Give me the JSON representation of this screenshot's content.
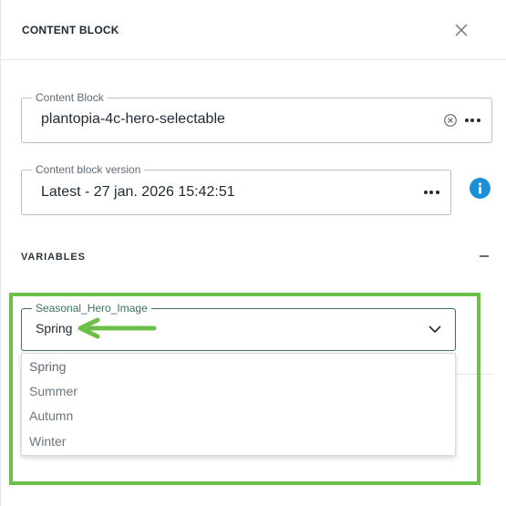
{
  "header": {
    "title": "CONTENT BLOCK",
    "close_icon": "close-icon"
  },
  "content_block": {
    "label": "Content Block",
    "value": "plantopia-4c-hero-selectable",
    "clear_icon": "clear-circle-icon",
    "more_icon": "more-horizontal-icon"
  },
  "version": {
    "label": "Content block version",
    "value": "Latest - 27 jan. 2026 15:42:51",
    "more_icon": "more-horizontal-icon",
    "info_icon": "info-icon"
  },
  "variables": {
    "title": "VARIABLES",
    "collapse_icon": "minus-icon",
    "select": {
      "label": "Seasonal_Hero_Image",
      "value": "Spring",
      "chevron_icon": "chevron-down-icon",
      "options": [
        "Spring",
        "Summer",
        "Autumn",
        "Winter"
      ]
    }
  },
  "colors": {
    "highlight": "#6cc04a",
    "info": "#1d8fd6",
    "select_border": "#3d6f64"
  }
}
